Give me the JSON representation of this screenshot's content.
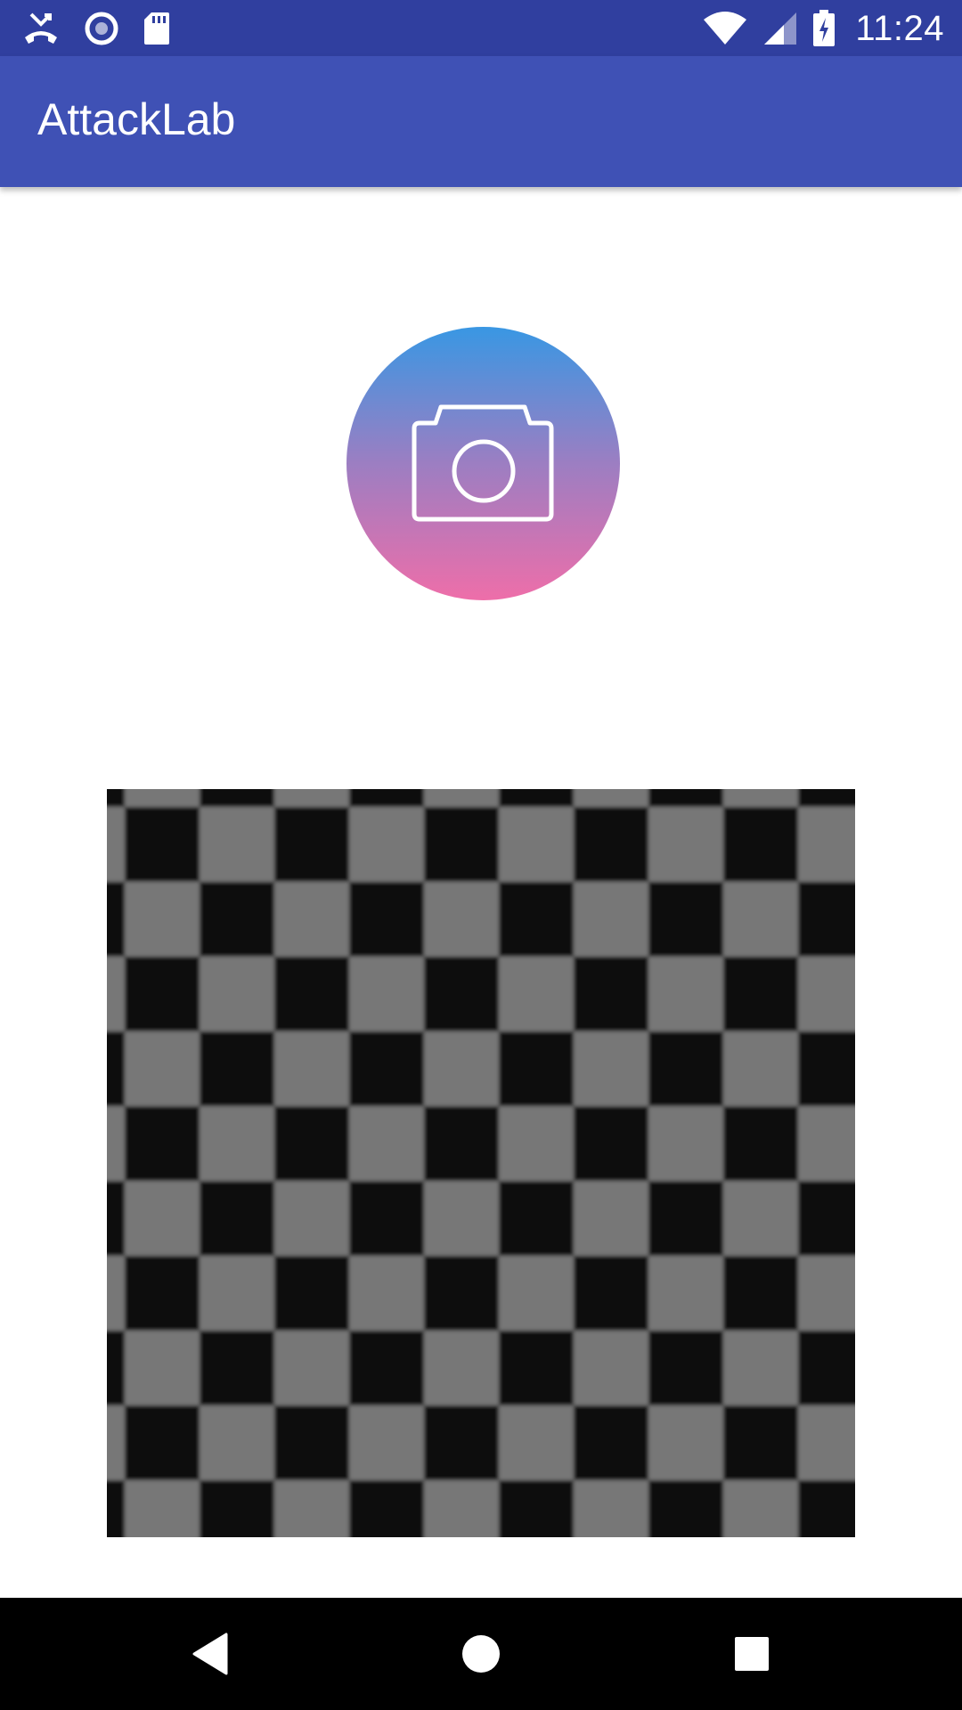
{
  "status_bar": {
    "time": "11:24",
    "left_icons": [
      "missed-call-icon",
      "record-icon",
      "sd-card-icon"
    ],
    "right_icons": [
      "wifi-icon",
      "signal-icon",
      "battery-charging-icon"
    ],
    "background": "#303f9f"
  },
  "app_bar": {
    "title": "AttackLab",
    "background": "#3f51b5"
  },
  "camera_button": {
    "icon": "camera-icon",
    "gradient": [
      "#3997e3",
      "#ee6ea9"
    ]
  },
  "checkerboard": {
    "icon": "checkerboard-image",
    "colors": [
      "#0a0a0a",
      "#777777"
    ]
  },
  "nav_bar": {
    "buttons": [
      "back-icon",
      "home-icon",
      "recents-icon"
    ],
    "background": "#000000"
  }
}
